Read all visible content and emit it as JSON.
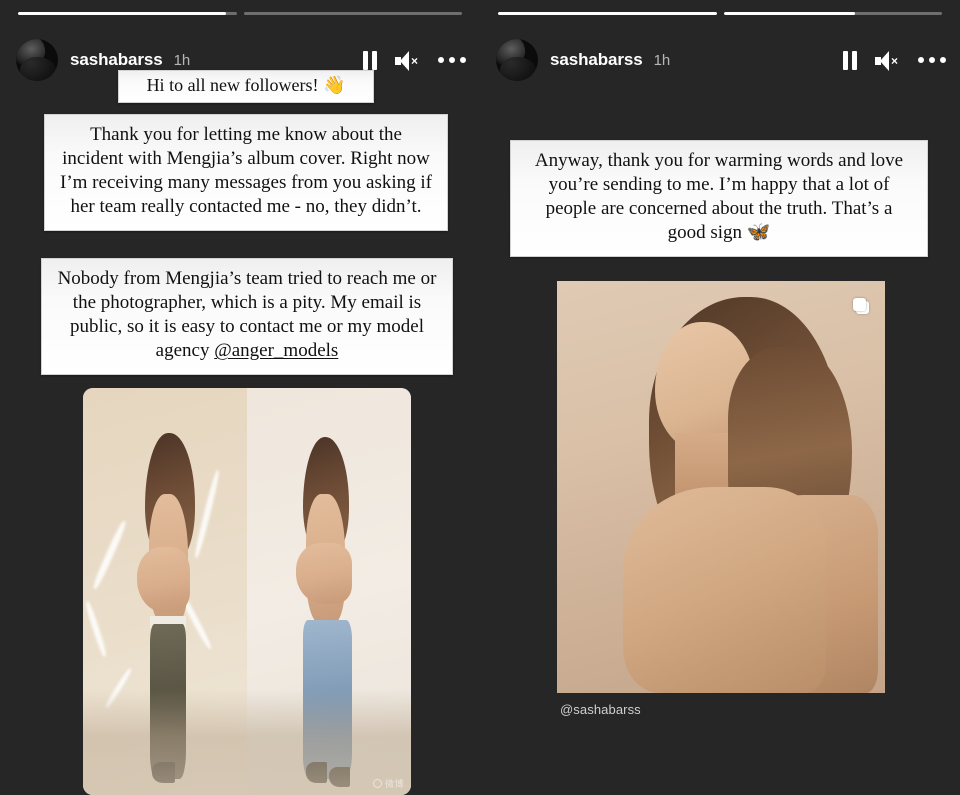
{
  "app": {
    "name": "Instagram Stories",
    "background_color": "#262626"
  },
  "panels": [
    {
      "id": "left",
      "progress_bars": [
        {
          "fill_percent": 95
        },
        {
          "fill_percent": 0
        }
      ],
      "header": {
        "avatar_name": "avatar",
        "username": "sashabarss",
        "timestamp": "1h",
        "controls": [
          {
            "icon": "pause-icon",
            "label": "Pause"
          },
          {
            "icon": "mute-icon",
            "label": "Sound off"
          },
          {
            "icon": "more-options-icon",
            "label": "More options"
          }
        ]
      },
      "text_cards": [
        {
          "id": "greeting",
          "text": "Hi to all new followers! 👋"
        },
        {
          "id": "statement-1",
          "text": "Thank you for letting me know about the incident with Mengjia’s album cover. Right now I’m receiving many messages from you asking if her team really contacted me - no, they didn’t."
        },
        {
          "id": "statement-2",
          "text_before_mention": "Nobody from Mengjia’s team tried to reach me or the photographer, which is a pity. My email is public, so it is easy to contact me or my model agency ",
          "mention": "@anger_models"
        }
      ],
      "media": {
        "type": "comparison-photo",
        "alt": "Side-by-side comparison of two photos of a model posing",
        "watermark": "微博"
      }
    },
    {
      "id": "right",
      "progress_bars": [
        {
          "fill_percent": 100
        },
        {
          "fill_percent": 60
        }
      ],
      "header": {
        "avatar_name": "avatar",
        "username": "sashabarss",
        "timestamp": "1h",
        "controls": [
          {
            "icon": "pause-icon",
            "label": "Pause"
          },
          {
            "icon": "mute-icon",
            "label": "Sound off"
          },
          {
            "icon": "more-options-icon",
            "label": "More options"
          }
        ]
      },
      "text_cards": [
        {
          "id": "statement-3",
          "text": "Anyway, thank you for warming words and love you’re sending to me. I’m happy that a lot of people are concerned about the truth. That’s a good sign 🦋"
        }
      ],
      "media": {
        "type": "portrait-photo",
        "alt": "Portrait of a woman in profile with arms crossed",
        "badge": "carousel-icon",
        "caption": "@sashabarss"
      }
    }
  ]
}
